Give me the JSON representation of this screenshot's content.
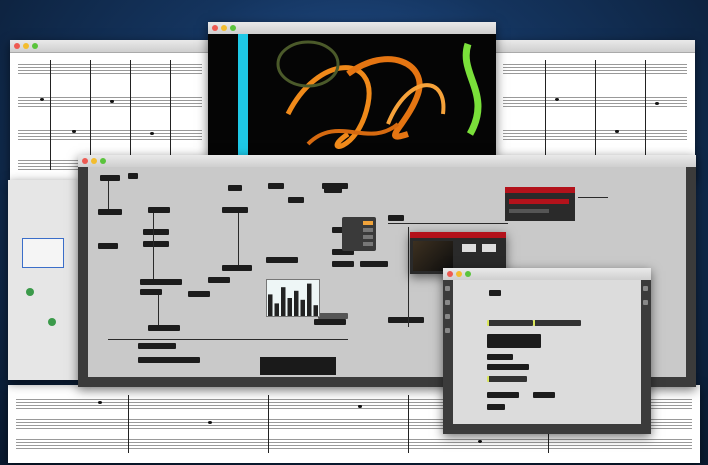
{
  "windows": {
    "score_left_title": "",
    "video_title": "",
    "patcher_title": "",
    "palette_title": ""
  },
  "colors": {
    "desktop": "#14345e",
    "video_cyan": "#1ec8e6",
    "video_orange": "#f08a1a",
    "video_green": "#7ae03a",
    "patcher_bg": "#c9c9c9",
    "toolbar": "#3b3b3b",
    "accent_red": "#b3121b",
    "highlight_yellow": "#d9e65a"
  },
  "icons": [
    "close-icon",
    "minimize-icon",
    "zoom-icon",
    "lock-icon",
    "grid-icon",
    "wrench-icon",
    "play-icon"
  ],
  "patcher": {
    "slider_values": [
      0.6,
      0.35,
      0.8,
      0.5,
      0.7,
      0.45,
      0.9,
      0.3
    ]
  }
}
